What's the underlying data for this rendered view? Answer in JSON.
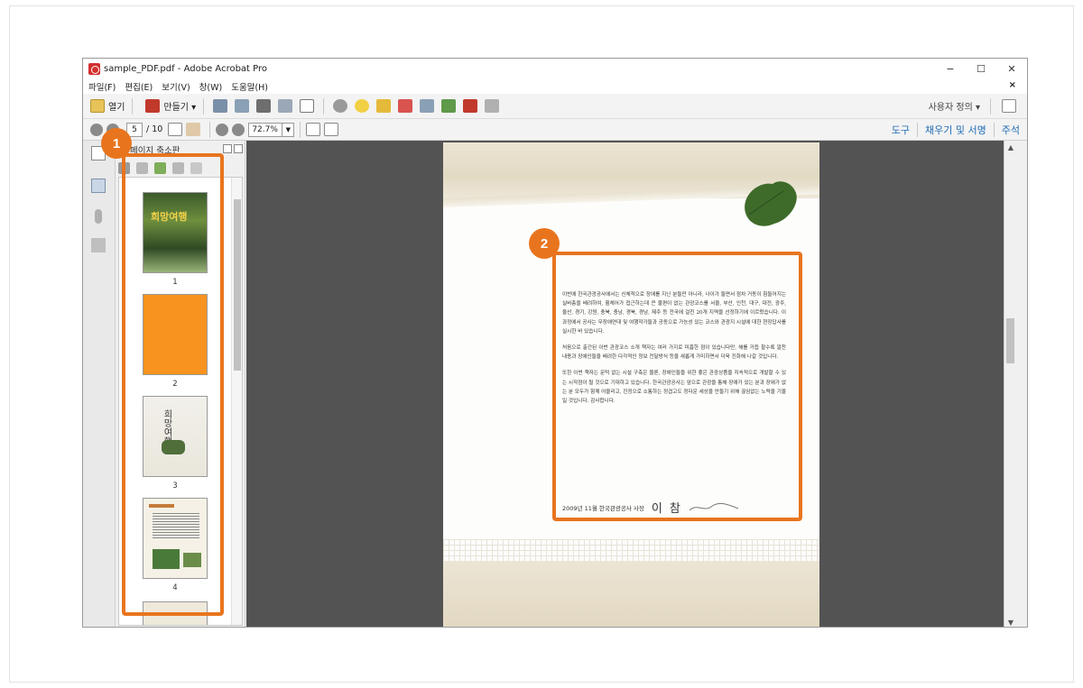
{
  "window": {
    "title": "sample_PDF.pdf - Adobe Acrobat Pro",
    "controls": [
      "−",
      "☐",
      "✕"
    ]
  },
  "menu": [
    "파일(F)",
    "편집(E)",
    "보기(V)",
    "창(W)",
    "도움말(H)"
  ],
  "toolbar": {
    "open_label": "열기",
    "create_label": "만들기 ▾",
    "customize_label": "사용자 정의 ▾"
  },
  "nav": {
    "current_page": "5",
    "total_pages": "/ 10",
    "zoom": "72.7%",
    "tools_link": "도구",
    "fill_sign_link": "채우기 및 서명",
    "comment_link": "주석"
  },
  "thumbnails": {
    "panel_title": "페이지 축소판",
    "pages": [
      {
        "number": "1",
        "cover_text": "희망여행"
      },
      {
        "number": "2"
      },
      {
        "number": "3",
        "cover_text": "희망여행"
      },
      {
        "number": "4"
      }
    ]
  },
  "document": {
    "paragraphs": [
      "이번에 한국관광공사에서는 신체적으로 장애를 지닌 분들만 아니라, 나이가 들면서 점차 거동이 힘들어지는 실버층을 배려하여, 휠체어가 접근하는데 큰 불편이 없는 관광코스를 서울, 부산, 인천, 대구, 대전, 광주, 울산, 경기, 강원, 충북, 충남, 경북, 경남, 제주 등 전국에 걸친 20개 지역을 선정하기에 이르렀습니다. 이 과정에서 공사는 무장애연대 및 여행작가들과 공동으로 가능성 있는 코스와 관광지 시설에 대한 현장답사를 실시한 바 있습니다.",
      "처음으로 출간된 이번 관광코스 소개 책자는 여러 가지로 미흡한 점이 있습니다만, 해를 거듭 할수록 알찬 내용과 장애인들을 배려한 다각적인 정보 전달방식 등을 새롭게 가미하면서 더욱 진화해 나갈 것입니다.",
      "또한 이번 책자는 문턱 없는 시설 구축은 물론, 장애인들을 위한 좋은 관광상품을 지속적으로 개발할 수 있는 시작점이 될 것으로 기대하고 있습니다. 한국관광공사는 앞으로 관광을 통해 장애가 있는 분과 장애가 없는 분 모두가 함께 어울리고, 진정으로 소통하는 정겹고도 정다운 세상을 만들기 위해 끊임없는 노력을 기울일 것입니다. 감사합니다."
    ],
    "signature_line": "2009년 11월  한국관광공사 사장",
    "signature_name": "이 참"
  },
  "callouts": [
    "1",
    "2"
  ],
  "colors": {
    "callout": "#e8751e",
    "accent_link": "#1f6db5",
    "page2_fill": "#f7931e",
    "viewer_bg": "#535353"
  }
}
